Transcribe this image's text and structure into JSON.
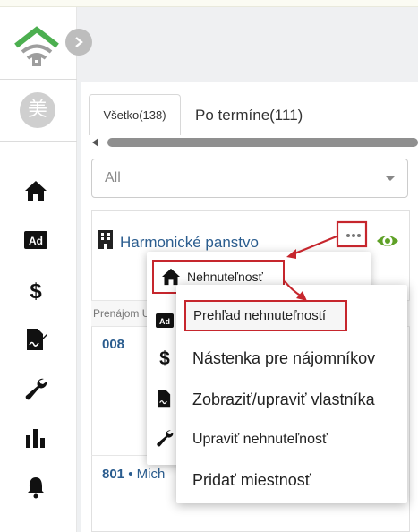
{
  "avatar": {
    "initial": "美"
  },
  "tabs": [
    {
      "label": "Všetko(138)"
    },
    {
      "label": "Po termíne(111)"
    }
  ],
  "filter": {
    "value": "All"
  },
  "card": {
    "title": "Harmonické panstvo",
    "section_label": "Prenájom U",
    "unit1": "008",
    "unit2_number": "801",
    "unit2_sep": " • ",
    "unit2_name": "Mich"
  },
  "menu1": {
    "items": [
      {
        "label": "Nehnuteľnosť",
        "icon": "home-icon"
      },
      {
        "icon": "ad-icon"
      },
      {
        "icon": "dollar-icon"
      },
      {
        "icon": "contract-icon"
      },
      {
        "icon": "wrench-icon"
      }
    ]
  },
  "menu2": {
    "items": [
      {
        "label": "Prehľad nehnuteľností"
      },
      {
        "label": "Nástenka pre nájomníkov"
      },
      {
        "label": "Zobraziť/upraviť vlastníka"
      },
      {
        "label": "Upraviť nehnuteľnosť"
      },
      {
        "label": "Pridať miestnosť"
      }
    ]
  },
  "sidebar": {
    "icons": [
      "home-icon",
      "ad-icon",
      "dollar-icon",
      "contract-icon",
      "wrench-icon",
      "chart-icon",
      "bell-icon"
    ]
  },
  "colors": {
    "logo_green": "#4caf50",
    "link_blue": "#2b5d8f",
    "highlight_red": "#c6262d",
    "eye_green": "#5fa127"
  }
}
